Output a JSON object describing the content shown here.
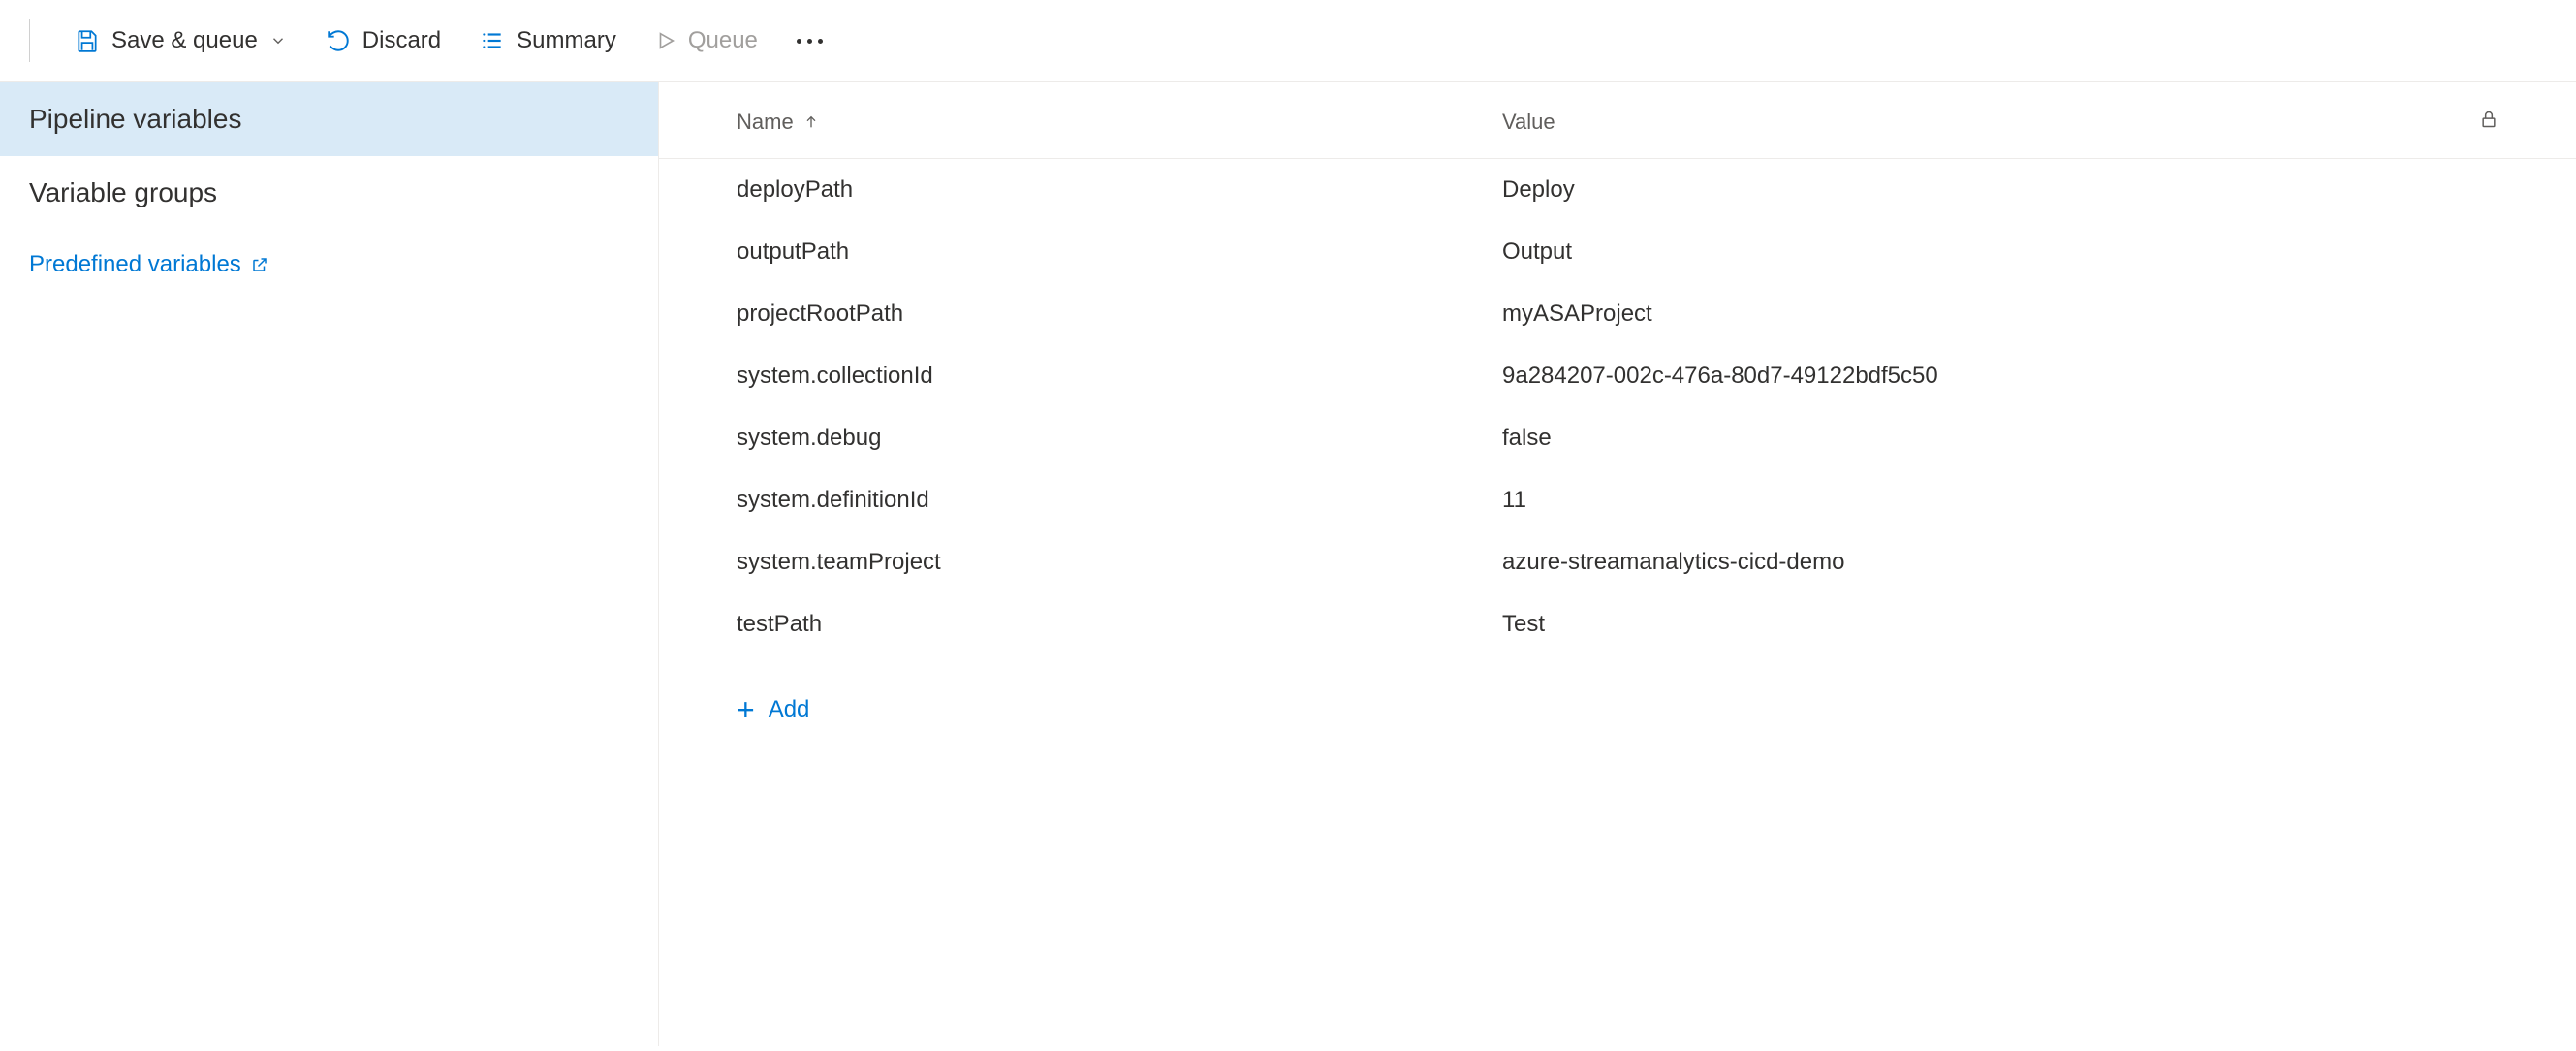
{
  "toolbar": {
    "save_queue_label": "Save & queue",
    "discard_label": "Discard",
    "summary_label": "Summary",
    "queue_label": "Queue"
  },
  "sidebar": {
    "items": [
      {
        "label": "Pipeline variables",
        "selected": true
      },
      {
        "label": "Variable groups",
        "selected": false
      }
    ],
    "predefined_link": "Predefined variables"
  },
  "table": {
    "headers": {
      "name": "Name",
      "value": "Value"
    },
    "rows": [
      {
        "name": "deployPath",
        "value": "Deploy"
      },
      {
        "name": "outputPath",
        "value": "Output"
      },
      {
        "name": "projectRootPath",
        "value": "myASAProject"
      },
      {
        "name": "system.collectionId",
        "value": "9a284207-002c-476a-80d7-49122bdf5c50"
      },
      {
        "name": "system.debug",
        "value": "false"
      },
      {
        "name": "system.definitionId",
        "value": "11"
      },
      {
        "name": "system.teamProject",
        "value": "azure-streamanalytics-cicd-demo"
      },
      {
        "name": "testPath",
        "value": "Test"
      }
    ]
  },
  "add_label": "Add"
}
